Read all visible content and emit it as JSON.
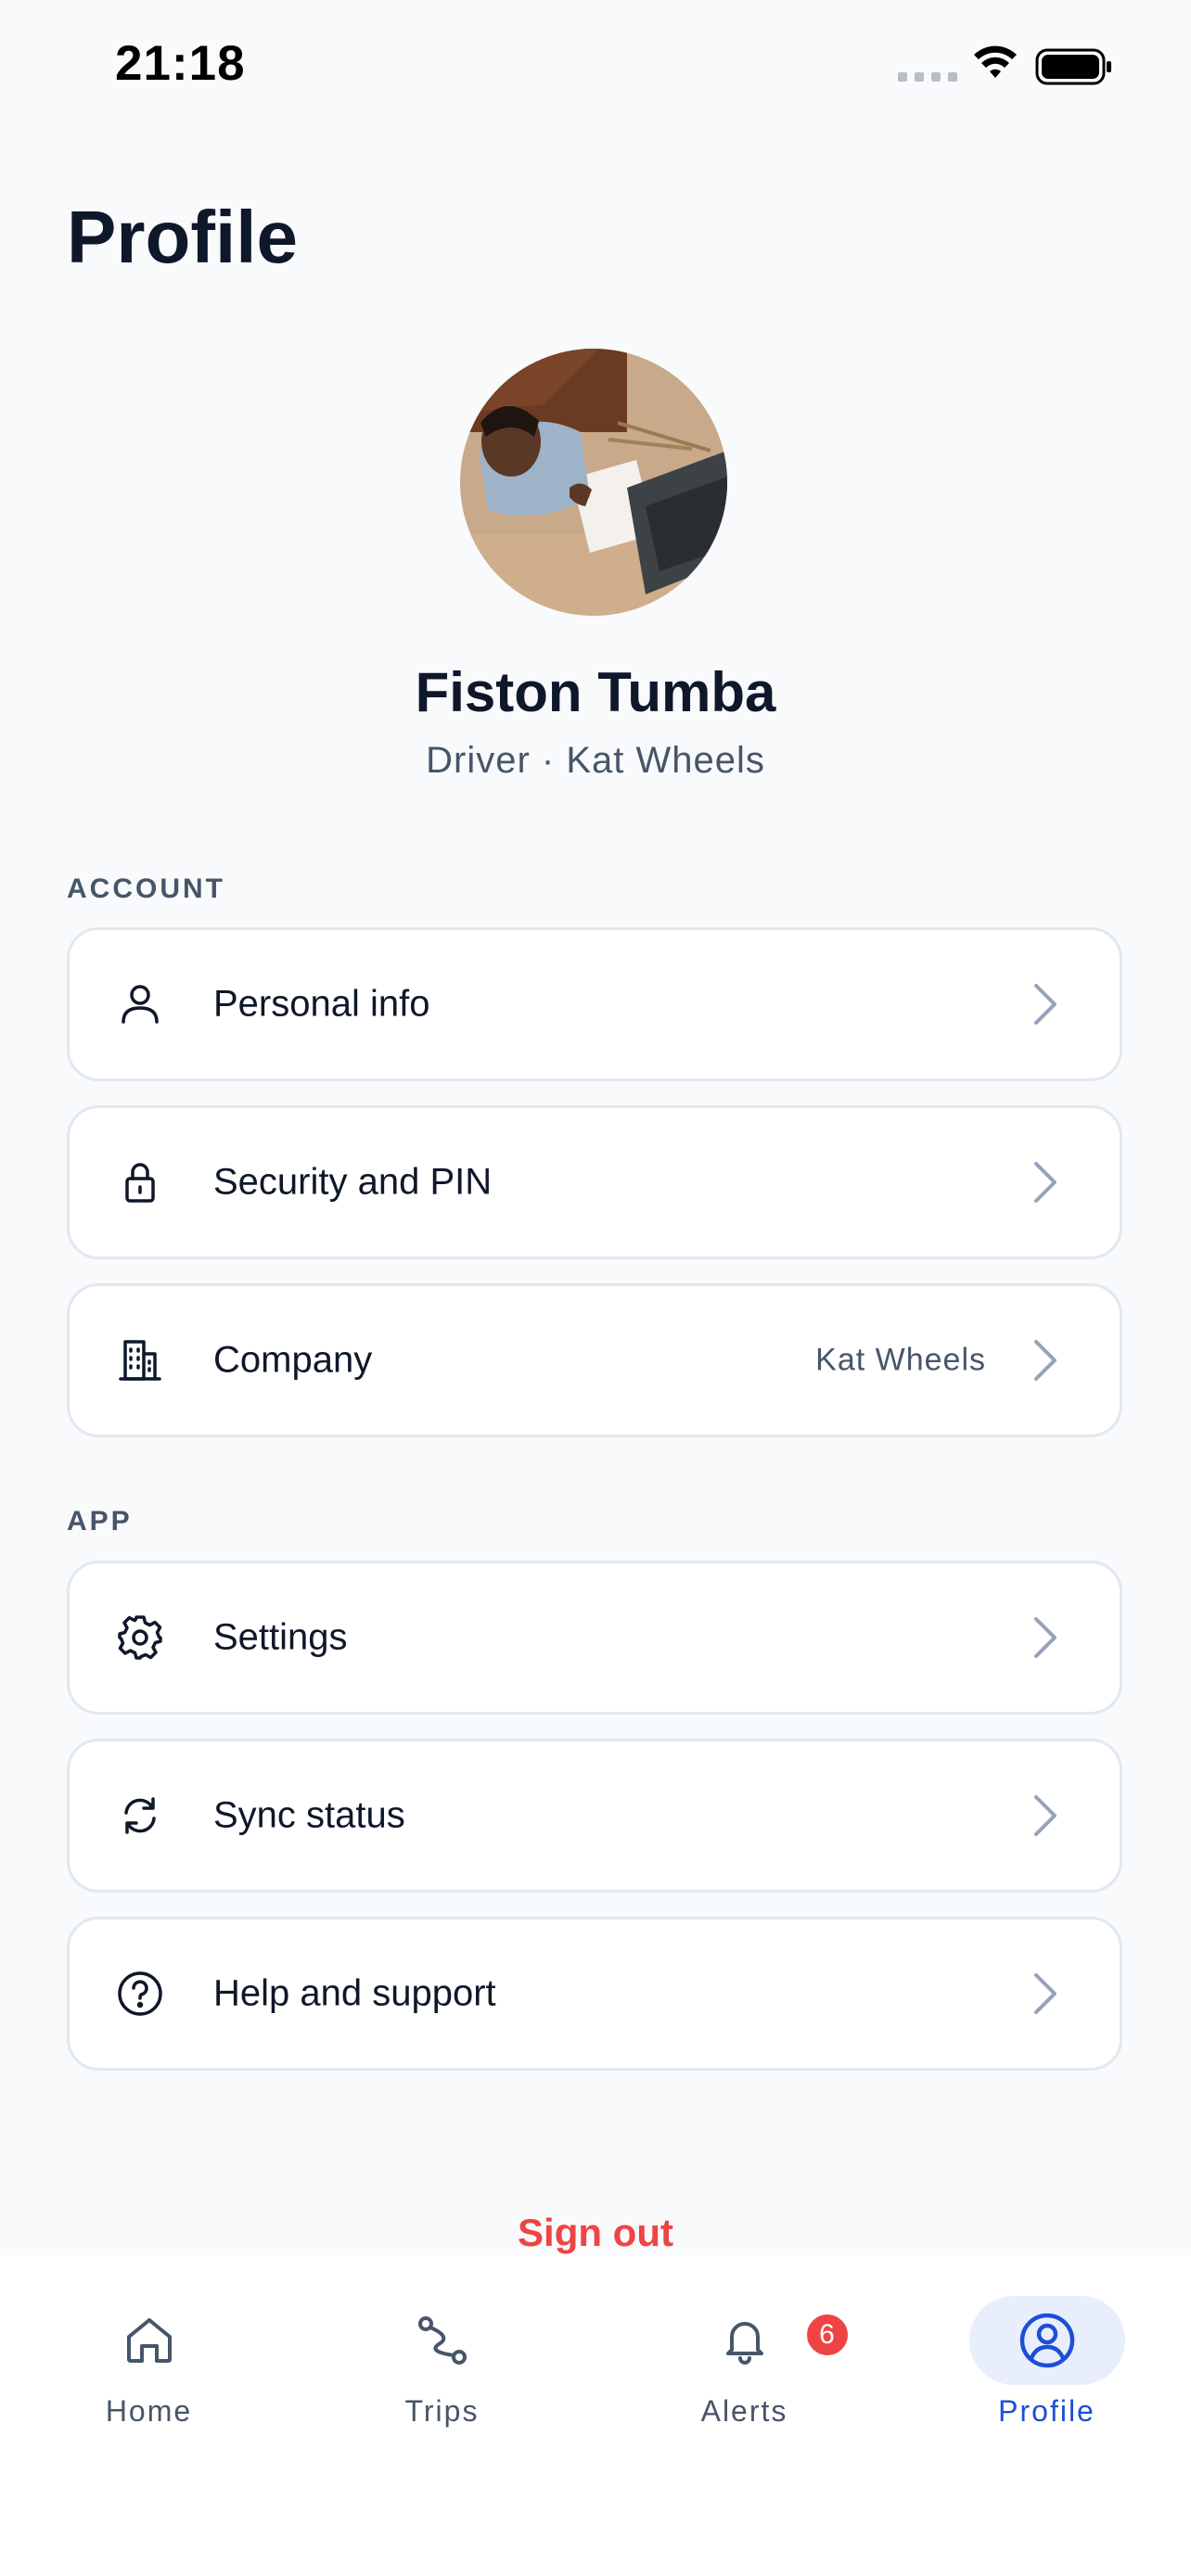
{
  "status_bar": {
    "time": "21:18"
  },
  "header": {
    "title": "Profile"
  },
  "profile": {
    "name": "Fiston Tumba",
    "role": "Driver · Kat Wheels"
  },
  "sections": {
    "account": {
      "label": "ACCOUNT",
      "items": [
        {
          "label": "Personal info",
          "icon": "person-icon"
        },
        {
          "label": "Security and PIN",
          "icon": "lock-icon"
        },
        {
          "label": "Company",
          "value": "Kat Wheels",
          "icon": "building-icon"
        }
      ]
    },
    "app": {
      "label": "APP",
      "items": [
        {
          "label": "Settings",
          "icon": "gear-icon"
        },
        {
          "label": "Sync status",
          "icon": "sync-icon"
        },
        {
          "label": "Help and support",
          "icon": "help-icon"
        }
      ]
    }
  },
  "sign_out": {
    "label": "Sign out"
  },
  "tab_bar": {
    "tabs": [
      {
        "label": "Home",
        "icon": "home-icon"
      },
      {
        "label": "Trips",
        "icon": "route-icon"
      },
      {
        "label": "Alerts",
        "icon": "bell-icon",
        "badge": "6"
      },
      {
        "label": "Profile",
        "icon": "profile-icon",
        "active": true
      }
    ]
  },
  "colors": {
    "accent": "#1d4ed8",
    "danger": "#ef4444",
    "background": "#f8fafc"
  }
}
